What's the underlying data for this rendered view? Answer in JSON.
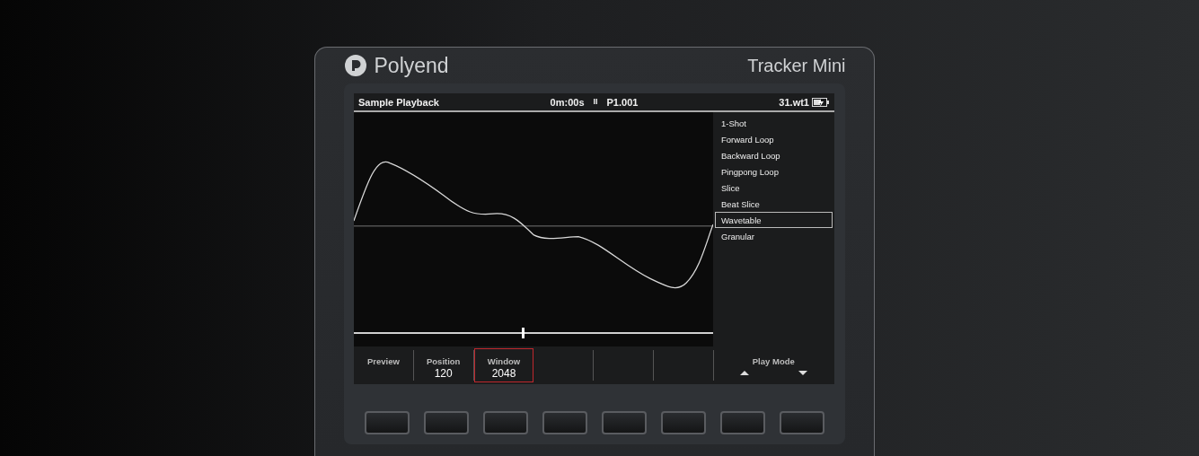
{
  "device": {
    "brand": "Polyend",
    "model": "Tracker Mini"
  },
  "header": {
    "title": "Sample Playback",
    "time": "0m:00s",
    "transport": "II",
    "pattern": "P1.001",
    "file": "31.wt1"
  },
  "play_modes": [
    {
      "label": "1-Shot",
      "selected": false
    },
    {
      "label": "Forward Loop",
      "selected": false
    },
    {
      "label": "Backward Loop",
      "selected": false
    },
    {
      "label": "Pingpong Loop",
      "selected": false
    },
    {
      "label": "Slice",
      "selected": false
    },
    {
      "label": "Beat Slice",
      "selected": false
    },
    {
      "label": "Wavetable",
      "selected": true
    },
    {
      "label": "Granular",
      "selected": false
    }
  ],
  "position_slider": {
    "level": 0.47
  },
  "params": [
    {
      "kind": "label",
      "label": "Preview",
      "selected": false
    },
    {
      "kind": "value",
      "label": "Position",
      "value": "120",
      "selected": false
    },
    {
      "kind": "value",
      "label": "Window",
      "value": "2048",
      "selected": true
    },
    {
      "kind": "empty",
      "selected": false
    },
    {
      "kind": "empty",
      "selected": false
    },
    {
      "kind": "empty",
      "selected": false
    },
    {
      "kind": "arrows",
      "label": "Play Mode",
      "selected": false
    }
  ]
}
